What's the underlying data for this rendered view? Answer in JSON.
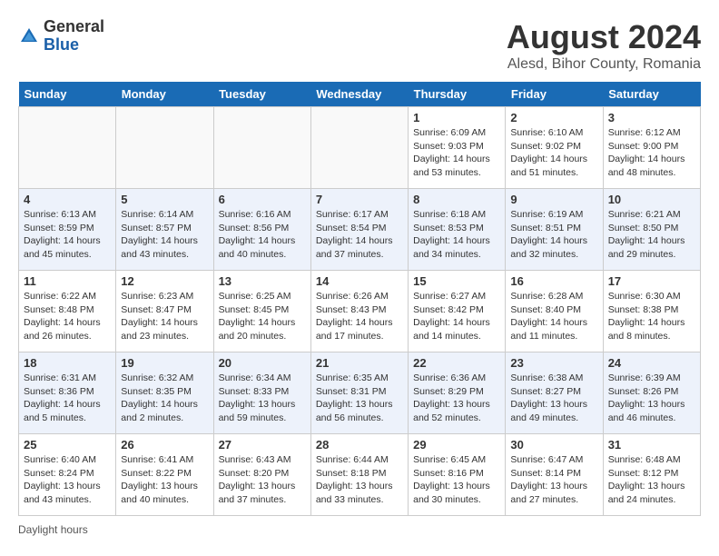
{
  "logo": {
    "general": "General",
    "blue": "Blue"
  },
  "title": "August 2024",
  "subtitle": "Alesd, Bihor County, Romania",
  "days_header": [
    "Sunday",
    "Monday",
    "Tuesday",
    "Wednesday",
    "Thursday",
    "Friday",
    "Saturday"
  ],
  "weeks": [
    [
      {
        "num": "",
        "info": ""
      },
      {
        "num": "",
        "info": ""
      },
      {
        "num": "",
        "info": ""
      },
      {
        "num": "",
        "info": ""
      },
      {
        "num": "1",
        "info": "Sunrise: 6:09 AM\nSunset: 9:03 PM\nDaylight: 14 hours\nand 53 minutes."
      },
      {
        "num": "2",
        "info": "Sunrise: 6:10 AM\nSunset: 9:02 PM\nDaylight: 14 hours\nand 51 minutes."
      },
      {
        "num": "3",
        "info": "Sunrise: 6:12 AM\nSunset: 9:00 PM\nDaylight: 14 hours\nand 48 minutes."
      }
    ],
    [
      {
        "num": "4",
        "info": "Sunrise: 6:13 AM\nSunset: 8:59 PM\nDaylight: 14 hours\nand 45 minutes."
      },
      {
        "num": "5",
        "info": "Sunrise: 6:14 AM\nSunset: 8:57 PM\nDaylight: 14 hours\nand 43 minutes."
      },
      {
        "num": "6",
        "info": "Sunrise: 6:16 AM\nSunset: 8:56 PM\nDaylight: 14 hours\nand 40 minutes."
      },
      {
        "num": "7",
        "info": "Sunrise: 6:17 AM\nSunset: 8:54 PM\nDaylight: 14 hours\nand 37 minutes."
      },
      {
        "num": "8",
        "info": "Sunrise: 6:18 AM\nSunset: 8:53 PM\nDaylight: 14 hours\nand 34 minutes."
      },
      {
        "num": "9",
        "info": "Sunrise: 6:19 AM\nSunset: 8:51 PM\nDaylight: 14 hours\nand 32 minutes."
      },
      {
        "num": "10",
        "info": "Sunrise: 6:21 AM\nSunset: 8:50 PM\nDaylight: 14 hours\nand 29 minutes."
      }
    ],
    [
      {
        "num": "11",
        "info": "Sunrise: 6:22 AM\nSunset: 8:48 PM\nDaylight: 14 hours\nand 26 minutes."
      },
      {
        "num": "12",
        "info": "Sunrise: 6:23 AM\nSunset: 8:47 PM\nDaylight: 14 hours\nand 23 minutes."
      },
      {
        "num": "13",
        "info": "Sunrise: 6:25 AM\nSunset: 8:45 PM\nDaylight: 14 hours\nand 20 minutes."
      },
      {
        "num": "14",
        "info": "Sunrise: 6:26 AM\nSunset: 8:43 PM\nDaylight: 14 hours\nand 17 minutes."
      },
      {
        "num": "15",
        "info": "Sunrise: 6:27 AM\nSunset: 8:42 PM\nDaylight: 14 hours\nand 14 minutes."
      },
      {
        "num": "16",
        "info": "Sunrise: 6:28 AM\nSunset: 8:40 PM\nDaylight: 14 hours\nand 11 minutes."
      },
      {
        "num": "17",
        "info": "Sunrise: 6:30 AM\nSunset: 8:38 PM\nDaylight: 14 hours\nand 8 minutes."
      }
    ],
    [
      {
        "num": "18",
        "info": "Sunrise: 6:31 AM\nSunset: 8:36 PM\nDaylight: 14 hours\nand 5 minutes."
      },
      {
        "num": "19",
        "info": "Sunrise: 6:32 AM\nSunset: 8:35 PM\nDaylight: 14 hours\nand 2 minutes."
      },
      {
        "num": "20",
        "info": "Sunrise: 6:34 AM\nSunset: 8:33 PM\nDaylight: 13 hours\nand 59 minutes."
      },
      {
        "num": "21",
        "info": "Sunrise: 6:35 AM\nSunset: 8:31 PM\nDaylight: 13 hours\nand 56 minutes."
      },
      {
        "num": "22",
        "info": "Sunrise: 6:36 AM\nSunset: 8:29 PM\nDaylight: 13 hours\nand 52 minutes."
      },
      {
        "num": "23",
        "info": "Sunrise: 6:38 AM\nSunset: 8:27 PM\nDaylight: 13 hours\nand 49 minutes."
      },
      {
        "num": "24",
        "info": "Sunrise: 6:39 AM\nSunset: 8:26 PM\nDaylight: 13 hours\nand 46 minutes."
      }
    ],
    [
      {
        "num": "25",
        "info": "Sunrise: 6:40 AM\nSunset: 8:24 PM\nDaylight: 13 hours\nand 43 minutes."
      },
      {
        "num": "26",
        "info": "Sunrise: 6:41 AM\nSunset: 8:22 PM\nDaylight: 13 hours\nand 40 minutes."
      },
      {
        "num": "27",
        "info": "Sunrise: 6:43 AM\nSunset: 8:20 PM\nDaylight: 13 hours\nand 37 minutes."
      },
      {
        "num": "28",
        "info": "Sunrise: 6:44 AM\nSunset: 8:18 PM\nDaylight: 13 hours\nand 33 minutes."
      },
      {
        "num": "29",
        "info": "Sunrise: 6:45 AM\nSunset: 8:16 PM\nDaylight: 13 hours\nand 30 minutes."
      },
      {
        "num": "30",
        "info": "Sunrise: 6:47 AM\nSunset: 8:14 PM\nDaylight: 13 hours\nand 27 minutes."
      },
      {
        "num": "31",
        "info": "Sunrise: 6:48 AM\nSunset: 8:12 PM\nDaylight: 13 hours\nand 24 minutes."
      }
    ]
  ],
  "footer": "Daylight hours"
}
